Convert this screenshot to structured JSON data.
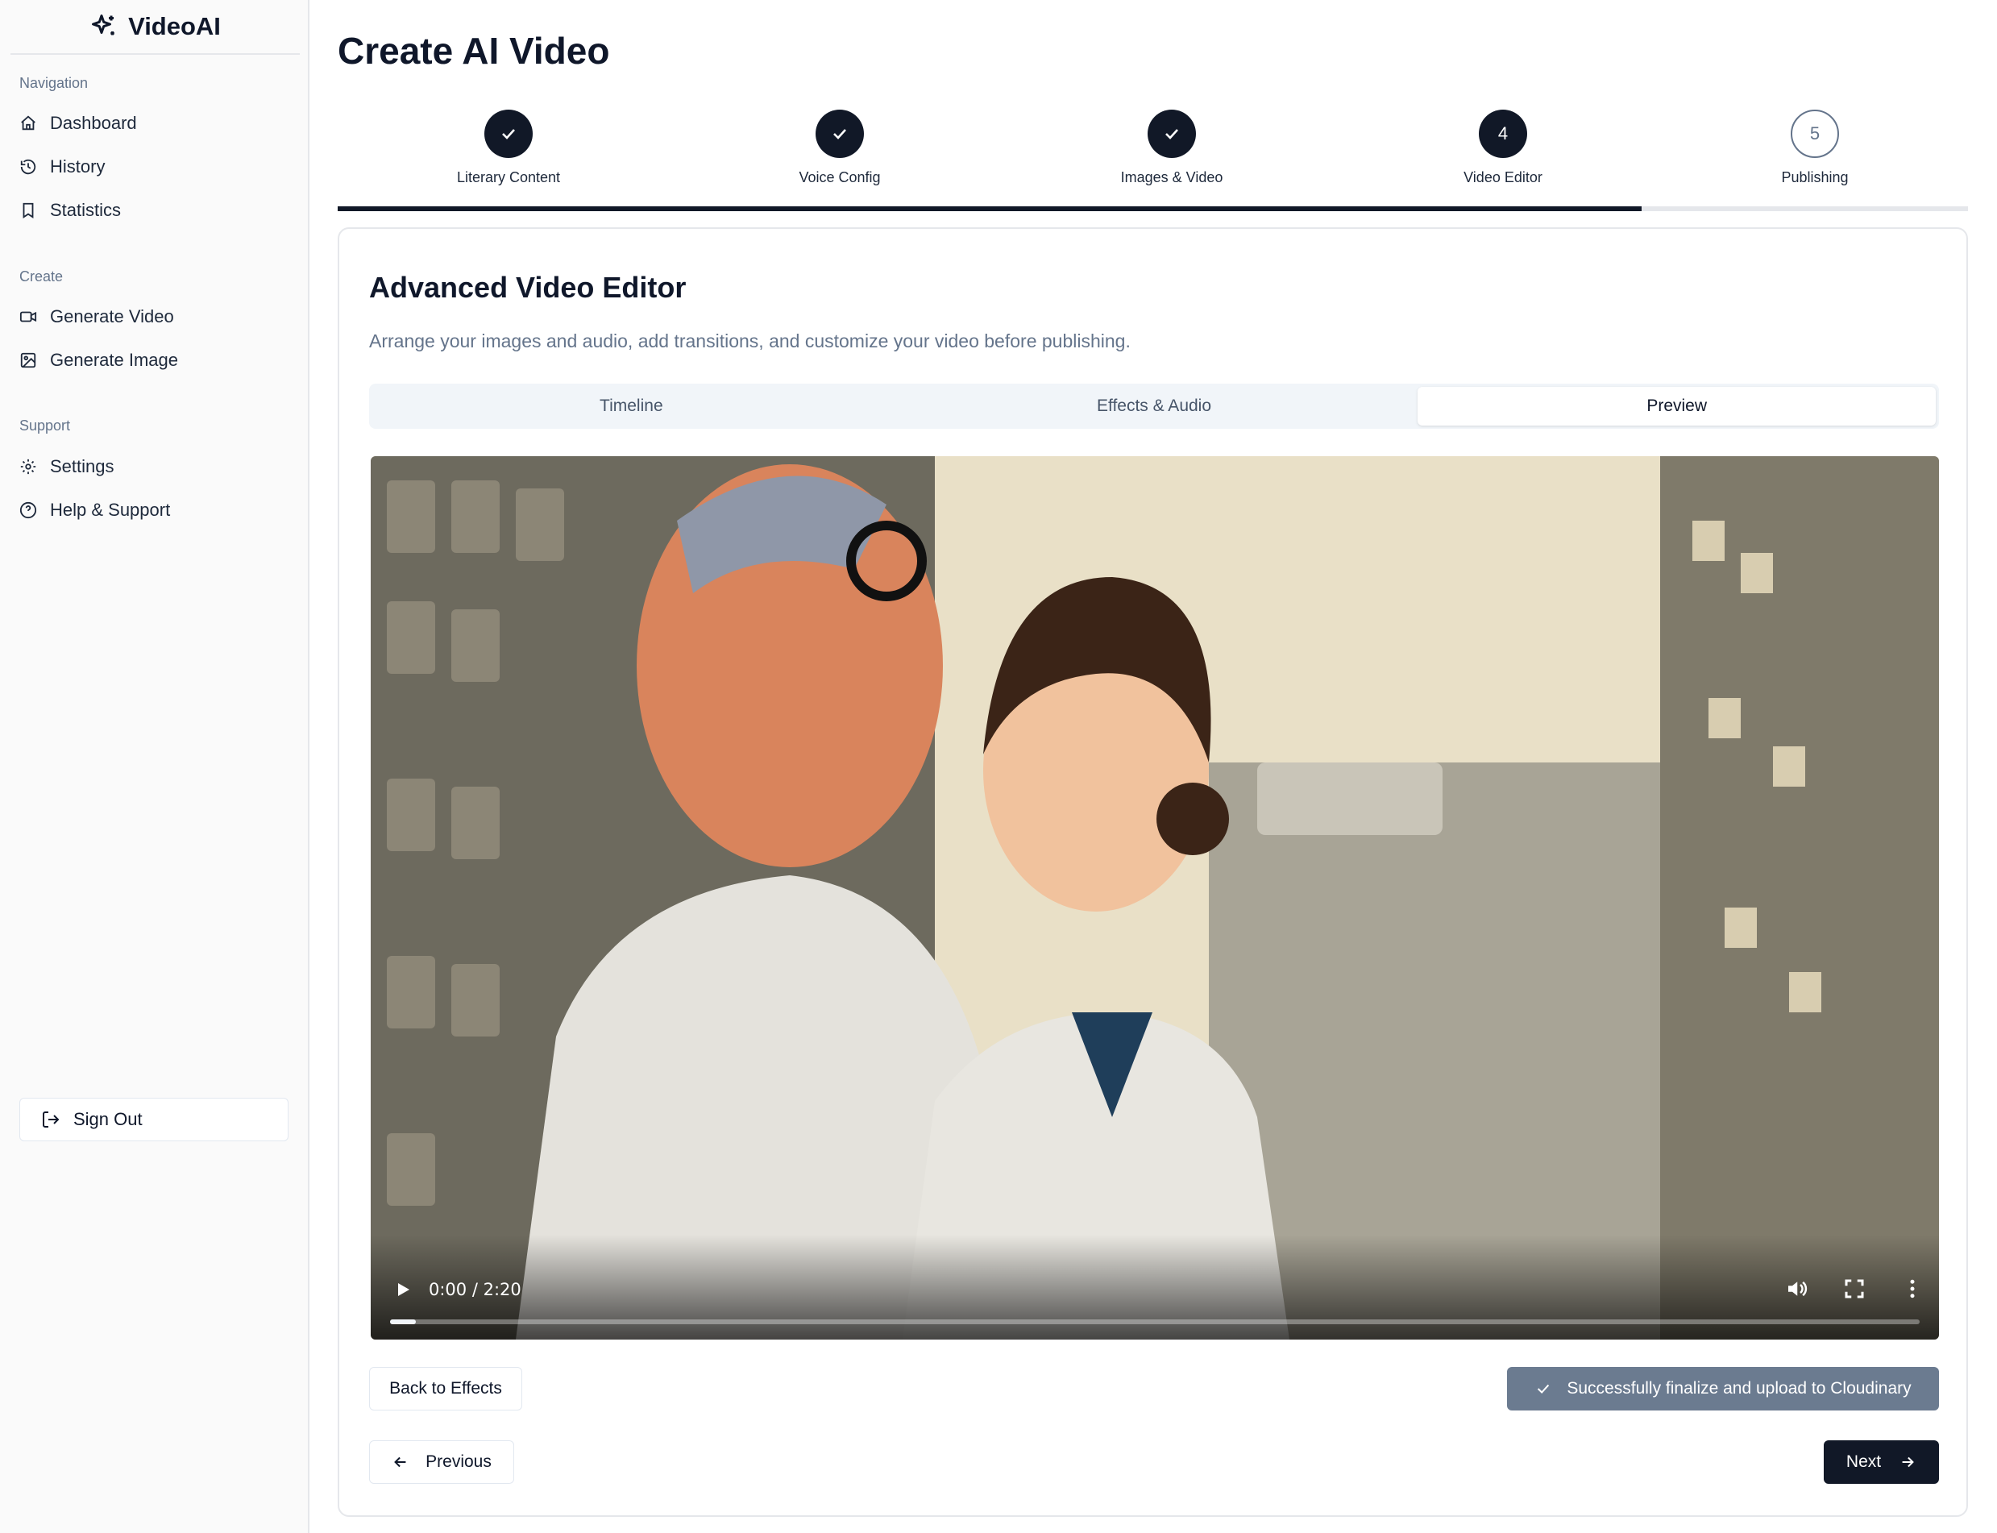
{
  "brand": {
    "name": "VideoAI",
    "icon": "sparkles-icon"
  },
  "sidebar": {
    "sections": [
      {
        "label": "Navigation",
        "items": [
          {
            "label": "Dashboard",
            "icon": "home-icon"
          },
          {
            "label": "History",
            "icon": "history-icon"
          },
          {
            "label": "Statistics",
            "icon": "bookmark-icon"
          }
        ]
      },
      {
        "label": "Create",
        "items": [
          {
            "label": "Generate Video",
            "icon": "video-camera-icon"
          },
          {
            "label": "Generate Image",
            "icon": "image-icon"
          }
        ]
      },
      {
        "label": "Support",
        "items": [
          {
            "label": "Settings",
            "icon": "gear-icon"
          },
          {
            "label": "Help & Support",
            "icon": "help-circle-icon"
          }
        ]
      }
    ],
    "sign_out": "Sign Out"
  },
  "page": {
    "title": "Create AI Video"
  },
  "stepper": {
    "steps": [
      {
        "label": "Literary Content",
        "state": "done",
        "number": "1"
      },
      {
        "label": "Voice Config",
        "state": "done",
        "number": "2"
      },
      {
        "label": "Images & Video",
        "state": "done",
        "number": "3"
      },
      {
        "label": "Video Editor",
        "state": "active",
        "number": "4"
      },
      {
        "label": "Publishing",
        "state": "pending",
        "number": "5"
      }
    ],
    "progress": 0.8
  },
  "editor": {
    "title": "Advanced Video Editor",
    "description": "Arrange your images and audio, add transitions, and customize your video before publishing.",
    "tabs": [
      {
        "label": "Timeline",
        "active": false
      },
      {
        "label": "Effects & Audio",
        "active": false
      },
      {
        "label": "Preview",
        "active": true
      }
    ],
    "video": {
      "time": "0:00 / 2:20",
      "played_fraction": 0.0
    },
    "back_button": "Back to Effects",
    "finalize_status": "Successfully finalize and upload to Cloudinary"
  },
  "footer": {
    "previous": "Previous",
    "next": "Next"
  },
  "colors": {
    "primary": "#111827",
    "muted": "#64748b",
    "border": "#e5e7eb"
  }
}
